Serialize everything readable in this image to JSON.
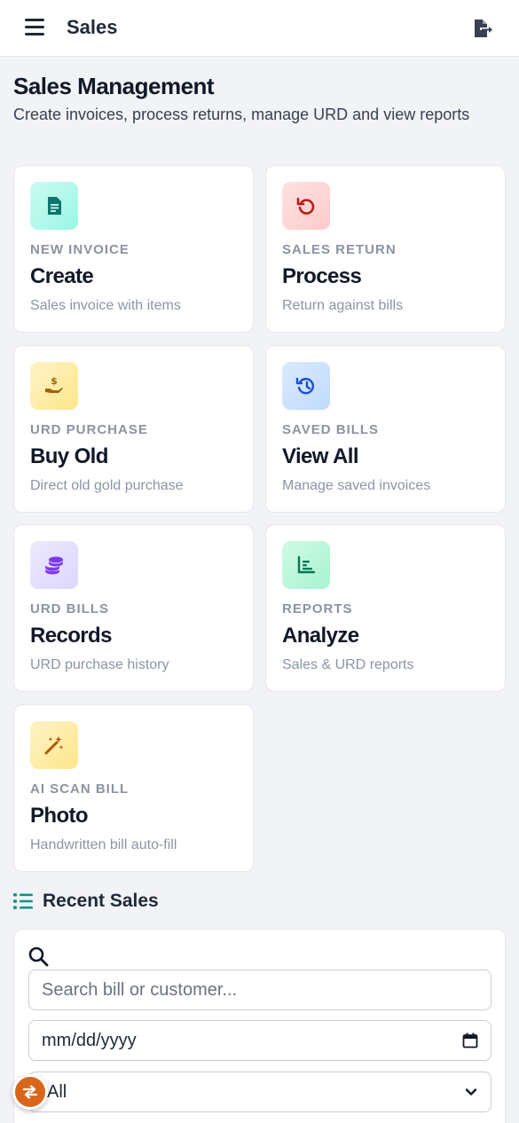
{
  "header": {
    "title": "Sales"
  },
  "page": {
    "title": "Sales Management",
    "subtitle": "Create invoices, process returns, manage URD and view reports"
  },
  "cards": [
    {
      "kicker": "NEW INVOICE",
      "headline": "Create",
      "desc": "Sales invoice with items",
      "icon": "invoice-icon",
      "color": "#0f766e"
    },
    {
      "kicker": "SALES RETURN",
      "headline": "Process",
      "desc": "Return against bills",
      "icon": "undo-icon",
      "color": "#b91c1c"
    },
    {
      "kicker": "URD PURCHASE",
      "headline": "Buy Old",
      "desc": "Direct old gold purchase",
      "icon": "hand-money-icon",
      "color": "#a16207"
    },
    {
      "kicker": "SAVED BILLS",
      "headline": "View All",
      "desc": "Manage saved invoices",
      "icon": "history-icon",
      "color": "#1d4ed8"
    },
    {
      "kicker": "URD BILLS",
      "headline": "Records",
      "desc": "URD purchase history",
      "icon": "coins-icon",
      "color": "#7c3aed"
    },
    {
      "kicker": "REPORTS",
      "headline": "Analyze",
      "desc": "Sales & URD reports",
      "icon": "chart-icon",
      "color": "#047857"
    },
    {
      "kicker": "AI SCAN BILL",
      "headline": "Photo",
      "desc": "Handwritten bill auto-fill",
      "icon": "magic-wand-icon",
      "color": "#b45309"
    }
  ],
  "recent": {
    "title": "Recent Sales",
    "search_placeholder": "Search bill or customer...",
    "date_value": "mm/dd/yyyy",
    "status_selected": "All"
  },
  "colors": {
    "accent": "#0d9488",
    "fab": "#d9651b"
  }
}
